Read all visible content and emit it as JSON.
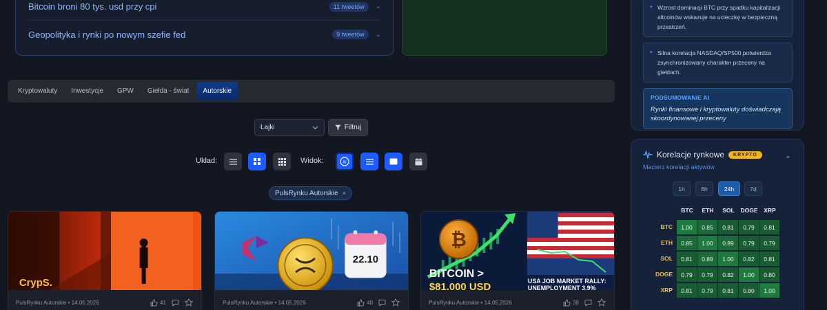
{
  "topics": [
    {
      "title": "Bitcoin broni 80 tys. usd przy cpi",
      "count": "11 tweetów"
    },
    {
      "title": "Geopolityka i rynki po nowym szefie fed",
      "count": "9 tweetów"
    }
  ],
  "tabs": [
    "Kryptowaluty",
    "Inwestycje",
    "GPW",
    "Giełda - świat",
    "Autorskie"
  ],
  "active_tab": "Autorskie",
  "filter": {
    "sort_value": "Lajki",
    "filter_label": "Filtruj"
  },
  "controls": {
    "layout_label": "Układ:",
    "view_label": "Widok:",
    "ai_icon_text": "AI"
  },
  "active_chip": "PulsRynku Autorskie",
  "cards": [
    {
      "author": "PulsRynku Autorskie • 14.05.2026",
      "likes": "41",
      "image_text": "CrypS."
    },
    {
      "author": "PulsRynku Autorskie • 14.05.2026",
      "likes": "40",
      "image_text": "22.10"
    },
    {
      "author": "PulsRynku Autorskie • 14.05.2026",
      "likes": "38",
      "image_text": "BITCOIN >",
      "image_text2": "$81,000 USD",
      "image_text3": "USA JOB MARKET RALLY:",
      "image_text4": "UNEMPLOYMENT 3.9%"
    }
  ],
  "sidebar": {
    "bullets": [
      "Wzrost dominacji BTC przy spadku kapitalizacji altcoinów wskazuje na ucieczkę w bezpieczną przestrzeń.",
      "Silna korelacja NASDAQ/SP500 potwierdza zsynchronizowany charakter przeceny na giełdach."
    ],
    "ai_summary_title": "PODSUMOWANIE AI",
    "ai_summary_text": "Rynki finansowe i kryptowaluty doświadczają skoordynowanej przeceny"
  },
  "correlations": {
    "title": "Korelacje rynkowe",
    "badge": "KRYPTO",
    "subtitle": "Macierz korelacji aktywów",
    "timeframes": [
      "1h",
      "6h",
      "24h",
      "7d"
    ],
    "active_timeframe": "24h",
    "assets": [
      "BTC",
      "ETH",
      "SOL",
      "DOGE",
      "XRP"
    ],
    "matrix": [
      [
        "1.00",
        "0.85",
        "0.81",
        "0.79",
        "0.81"
      ],
      [
        "0.85",
        "1.00",
        "0.89",
        "0.79",
        "0.79"
      ],
      [
        "0.81",
        "0.89",
        "1.00",
        "0.82",
        "0.81"
      ],
      [
        "0.79",
        "0.79",
        "0.82",
        "1.00",
        "0.80"
      ],
      [
        "0.81",
        "0.79",
        "0.81",
        "0.80",
        "1.00"
      ]
    ]
  },
  "colors": {
    "accent": "#1e5bff",
    "badge": "#f2b21b",
    "matrix_high": "#1e6b3a",
    "matrix_mid": "#1a5a34"
  }
}
